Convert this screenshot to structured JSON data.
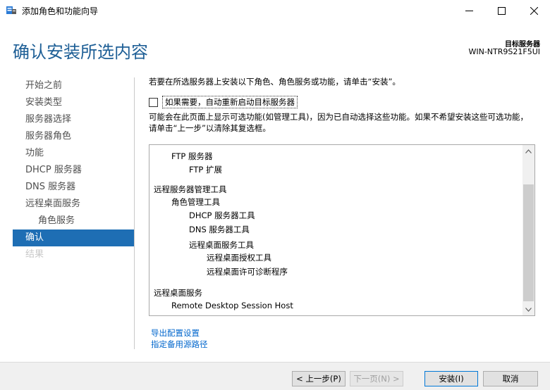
{
  "window": {
    "title": "添加角色和功能向导"
  },
  "header": {
    "page_title": "确认安装所选内容",
    "target_label": "目标服务器",
    "target_name": "WIN-NTR9S21F5UI"
  },
  "nav": {
    "items": [
      {
        "label": "开始之前",
        "state": "normal"
      },
      {
        "label": "安装类型",
        "state": "normal"
      },
      {
        "label": "服务器选择",
        "state": "normal"
      },
      {
        "label": "服务器角色",
        "state": "normal"
      },
      {
        "label": "功能",
        "state": "normal"
      },
      {
        "label": "DHCP 服务器",
        "state": "normal"
      },
      {
        "label": "DNS 服务器",
        "state": "normal"
      },
      {
        "label": "远程桌面服务",
        "state": "normal"
      },
      {
        "label": "角色服务",
        "state": "sub"
      },
      {
        "label": "确认",
        "state": "active"
      },
      {
        "label": "结果",
        "state": "disabled"
      }
    ]
  },
  "content": {
    "intro": "若要在所选服务器上安装以下角色、角色服务或功能，请单击“安装”。",
    "restart_label": "如果需要，自动重新启动目标服务器",
    "note": "可能会在此页面上显示可选功能(如管理工具)，因为已自动选择这些功能。如果不希望安装这些可选功能，请单击“上一步”以清除其复选框。",
    "list": [
      "FTP 服务器",
      "FTP 扩展",
      "远程服务器管理工具",
      "角色管理工具",
      "DHCP 服务器工具",
      "DNS 服务器工具",
      "远程桌面服务工具",
      "远程桌面授权工具",
      "远程桌面许可诊断程序",
      "远程桌面服务",
      "Remote Desktop Session Host"
    ],
    "links": {
      "export": "导出配置设置",
      "alt_source": "指定备用源路径"
    }
  },
  "footer": {
    "prev": "< 上一步(P)",
    "next": "下一页(N) >",
    "install": "安装(I)",
    "cancel": "取消"
  },
  "colors": {
    "accent": "#1e6eb4",
    "title": "#1e5f96",
    "link": "#0066cc"
  }
}
